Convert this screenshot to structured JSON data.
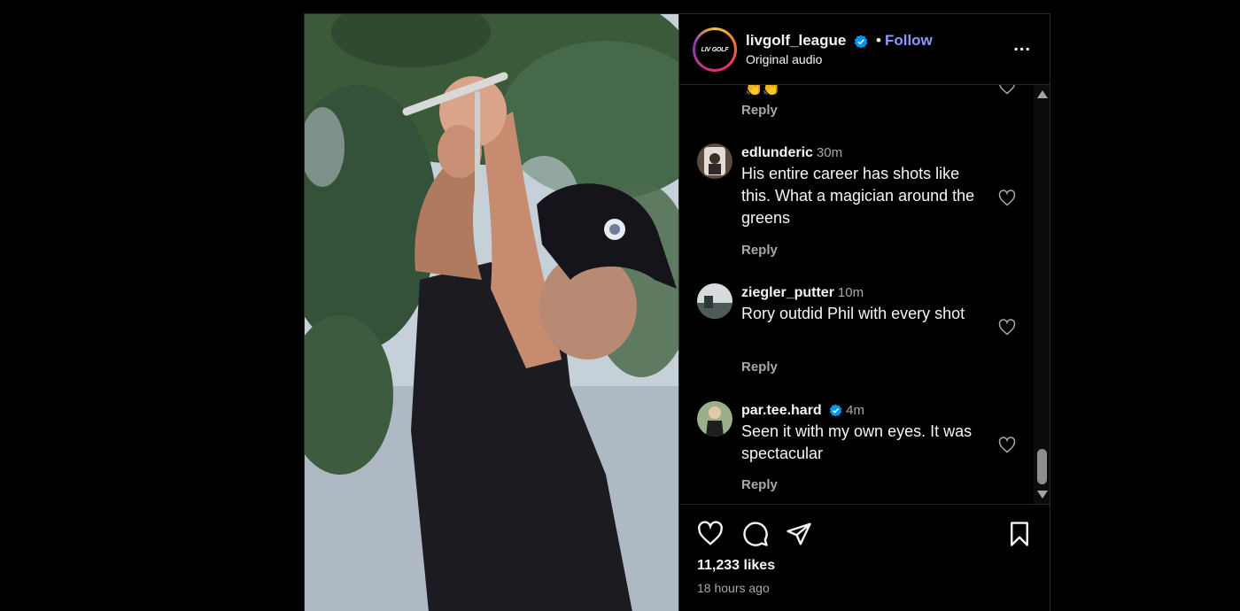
{
  "post": {
    "username": "livgolf_league",
    "follow_separator": "•",
    "follow_label": "Follow",
    "audio_label": "Original audio",
    "logo_text": "LIV GOLF",
    "more_label": "..."
  },
  "comments": [
    {
      "user": "",
      "time": "",
      "text": "",
      "reply": "Reply",
      "partial": true
    },
    {
      "user": "edlunderic",
      "time": "30m",
      "text": "His entire career has shots like this. What a magician around the greens",
      "reply": "Reply"
    },
    {
      "user": "ziegler_putter",
      "time": "10m",
      "text": "Rory outdid Phil with every shot",
      "reply": "Reply"
    },
    {
      "user": "par.tee.hard",
      "time": "4m",
      "text": "Seen it with my own eyes. It was spectacular",
      "reply": "Reply",
      "verified": true
    }
  ],
  "footer": {
    "likes": "11,233 likes",
    "posted": "18 hours ago"
  },
  "colors": {
    "follow": "#8e97ff",
    "verified": "#0095f6",
    "muted": "#a8a8a8"
  },
  "icons": [
    "verified-badge-icon",
    "more-options-icon",
    "heart-icon",
    "comment-icon",
    "share-icon",
    "bookmark-icon"
  ]
}
